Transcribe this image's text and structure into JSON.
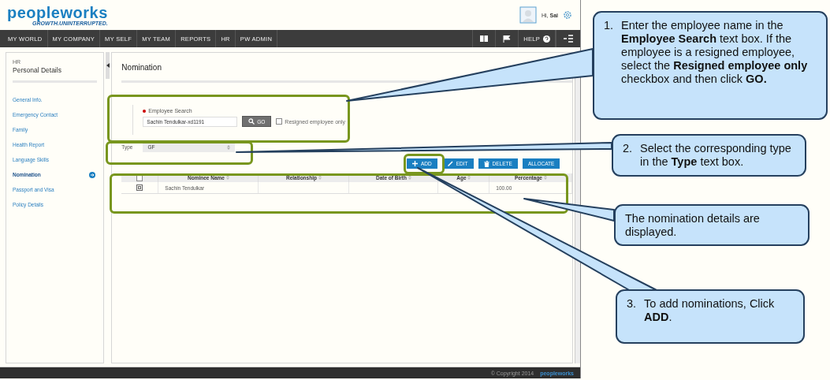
{
  "header": {
    "logo": "peopleworks",
    "tagline": "GROWTH.UNINTERRUPTED.",
    "greeting": "Hi, **Sai**"
  },
  "nav": {
    "items": [
      "MY WORLD",
      "MY COMPANY",
      "MY SELF",
      "MY TEAM",
      "REPORTS",
      "HR",
      "PW ADMIN"
    ],
    "help": "HELP"
  },
  "sidebar": {
    "section": "HR",
    "title": "Personal Details",
    "items": [
      {
        "label": "General Info.",
        "selected": false
      },
      {
        "label": "Emergency Contact",
        "selected": false
      },
      {
        "label": "Family",
        "selected": false
      },
      {
        "label": "Health Report",
        "selected": false
      },
      {
        "label": "Language Skills",
        "selected": false
      },
      {
        "label": "Nomination",
        "selected": true
      },
      {
        "label": "Passport and Visa",
        "selected": false
      },
      {
        "label": "Policy Details",
        "selected": false
      }
    ]
  },
  "main": {
    "title": "Nomination",
    "search": {
      "label": "Employee Search",
      "value": "Sachin Tendulkar-xd1191",
      "button": "GO",
      "checkbox_label": "Resigned employee only",
      "checked": false
    },
    "type": {
      "label": "Type",
      "value": "GF"
    },
    "actions": [
      {
        "kind": "add",
        "label": "ADD"
      },
      {
        "kind": "edit",
        "label": "EDIT"
      },
      {
        "kind": "delete",
        "label": "DELETE"
      },
      {
        "kind": "plain",
        "label": "ALLOCATE"
      }
    ],
    "table": {
      "all_checked": false,
      "columns": [
        "Nominee Name",
        "Relationship",
        "Date of Birth",
        "Age",
        "Percentage"
      ],
      "rows": [
        {
          "cells": [
            "Sachin Tendulkar",
            "",
            "",
            "",
            "100.00"
          ]
        }
      ]
    }
  },
  "callouts": [
    {
      "number": "1.",
      "text": "Enter the employee name in the **Employee Search**  text box. If the employee is a resigned employee, select  the **Resigned employee only** checkbox and then  click **GO.**"
    },
    {
      "number": "2.",
      "text": "Select the corresponding type in the **Type** text box."
    },
    {
      "text": "The nomination details are displayed."
    },
    {
      "number": "3.",
      "text": "To add nominations, Click **ADD**."
    }
  ],
  "footer": {
    "copyright": "© Copyright 2014",
    "logo": "peopleworks"
  }
}
